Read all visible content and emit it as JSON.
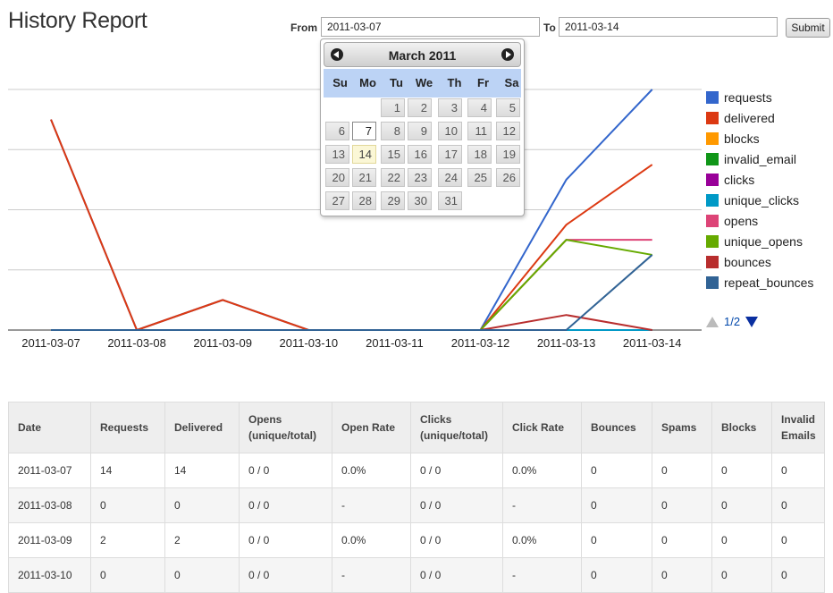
{
  "page": {
    "title": "History Report"
  },
  "form": {
    "from_label": "From",
    "from_value": "2011-03-07",
    "to_label": "To",
    "to_value": "2011-03-14",
    "submit_label": "Submit"
  },
  "calendar": {
    "month_title": "March 2011",
    "weekdays": [
      "Su",
      "Mo",
      "Tu",
      "We",
      "Th",
      "Fr",
      "Sa"
    ],
    "first_weekday_index": 2,
    "days_in_month": 31,
    "selected_day": 7,
    "highlighted_day": 14
  },
  "chart_data": {
    "type": "line",
    "categories": [
      "2011-03-07",
      "2011-03-08",
      "2011-03-09",
      "2011-03-10",
      "2011-03-11",
      "2011-03-12",
      "2011-03-13",
      "2011-03-14"
    ],
    "ylim": [
      0,
      16
    ],
    "grid": true,
    "legend": "right",
    "series": [
      {
        "name": "requests",
        "color": "#3366cc",
        "values": [
          14,
          0,
          2,
          0,
          0,
          0,
          10,
          16
        ]
      },
      {
        "name": "delivered",
        "color": "#dc3912",
        "values": [
          14,
          0,
          2,
          0,
          0,
          0,
          7,
          11
        ]
      },
      {
        "name": "blocks",
        "color": "#ff9900",
        "values": [
          0,
          0,
          0,
          0,
          0,
          0,
          0,
          0
        ]
      },
      {
        "name": "invalid_email",
        "color": "#109618",
        "values": [
          0,
          0,
          0,
          0,
          0,
          0,
          0,
          0
        ]
      },
      {
        "name": "clicks",
        "color": "#990099",
        "values": [
          0,
          0,
          0,
          0,
          0,
          0,
          0,
          0
        ]
      },
      {
        "name": "unique_clicks",
        "color": "#0099c6",
        "values": [
          0,
          0,
          0,
          0,
          0,
          0,
          0,
          0
        ]
      },
      {
        "name": "opens",
        "color": "#dd4477",
        "values": [
          0,
          0,
          0,
          0,
          0,
          0,
          6,
          6
        ]
      },
      {
        "name": "unique_opens",
        "color": "#66aa00",
        "values": [
          0,
          0,
          0,
          0,
          0,
          0,
          6,
          5
        ]
      },
      {
        "name": "bounces",
        "color": "#b82e2e",
        "values": [
          0,
          0,
          0,
          0,
          0,
          0,
          1,
          0
        ]
      },
      {
        "name": "repeat_bounces",
        "color": "#316395",
        "values": [
          0,
          0,
          0,
          0,
          0,
          0,
          0,
          5
        ]
      }
    ]
  },
  "legend_pager": {
    "text": "1/2"
  },
  "table": {
    "headers": [
      [
        "Date"
      ],
      [
        "Requests"
      ],
      [
        "Delivered"
      ],
      [
        "Opens",
        "(unique/total)"
      ],
      [
        "Open Rate"
      ],
      [
        "Clicks",
        "(unique/total)"
      ],
      [
        "Click Rate"
      ],
      [
        "Bounces"
      ],
      [
        "Spams"
      ],
      [
        "Blocks"
      ],
      [
        "Invalid",
        "Emails"
      ]
    ],
    "rows": [
      [
        "2011-03-07",
        "14",
        "14",
        "0 / 0",
        "0.0%",
        "0 / 0",
        "0.0%",
        "0",
        "0",
        "0",
        "0"
      ],
      [
        "2011-03-08",
        "0",
        "0",
        "0 / 0",
        "-",
        "0 / 0",
        "-",
        "0",
        "0",
        "0",
        "0"
      ],
      [
        "2011-03-09",
        "2",
        "2",
        "0 / 0",
        "0.0%",
        "0 / 0",
        "0.0%",
        "0",
        "0",
        "0",
        "0"
      ],
      [
        "2011-03-10",
        "0",
        "0",
        "0 / 0",
        "-",
        "0 / 0",
        "-",
        "0",
        "0",
        "0",
        "0"
      ]
    ]
  }
}
